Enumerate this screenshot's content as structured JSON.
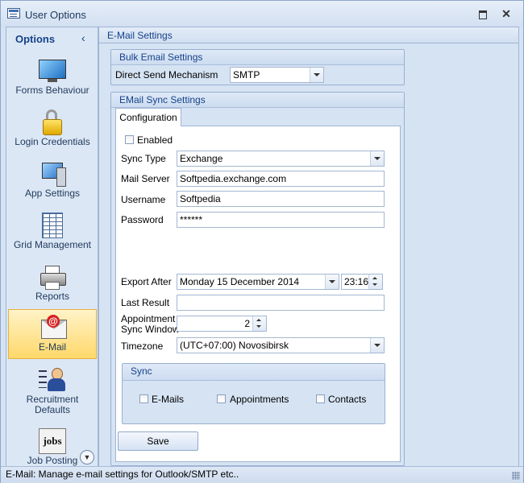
{
  "window": {
    "title": "User Options"
  },
  "sidebar": {
    "header": "Options",
    "items": [
      {
        "label": "Forms Behaviour",
        "icon": "monitor-icon"
      },
      {
        "label": "Login Credentials",
        "icon": "padlock-icon"
      },
      {
        "label": "App Settings",
        "icon": "computer-icon"
      },
      {
        "label": "Grid Management",
        "icon": "grid-icon"
      },
      {
        "label": "Reports",
        "icon": "printer-icon"
      },
      {
        "label": "E-Mail",
        "icon": "email-icon",
        "active": true
      },
      {
        "label": "Recruitment Defaults",
        "icon": "person-list-icon"
      },
      {
        "label": "Job Posting",
        "icon": "jobs-icon",
        "glyph": "jobs"
      }
    ]
  },
  "main": {
    "header": "E-Mail Settings",
    "bulk": {
      "title": "Bulk Email Settings",
      "mechanism_label": "Direct Send Mechanism",
      "mechanism_value": "SMTP"
    },
    "sync": {
      "title": "EMail Sync Settings",
      "tab_label": "Configuration",
      "enabled_label": "Enabled",
      "sync_type_label": "Sync Type",
      "sync_type_value": "Exchange",
      "mail_server_label": "Mail Server",
      "mail_server_value": "Softpedia.exchange.com",
      "username_label": "Username",
      "username_value": "Softpedia",
      "password_label": "Password",
      "password_value": "******",
      "export_after_label": "Export After",
      "export_after_date": "Monday 15 December 2014",
      "export_after_time": "23:16",
      "last_result_label": "Last Result",
      "last_result_value": "",
      "appointment_window_label_1": "Appointment",
      "appointment_window_label_2": "Sync Window",
      "appointment_window_value": "2",
      "timezone_label": "Timezone",
      "timezone_value": "(UTC+07:00) Novosibirsk",
      "sync_group": {
        "title": "Sync",
        "emails_label": "E-Mails",
        "appointments_label": "Appointments",
        "contacts_label": "Contacts"
      },
      "save_label": "Save"
    }
  },
  "status": {
    "text": "E-Mail: Manage e-mail settings for Outlook/SMTP etc.."
  }
}
